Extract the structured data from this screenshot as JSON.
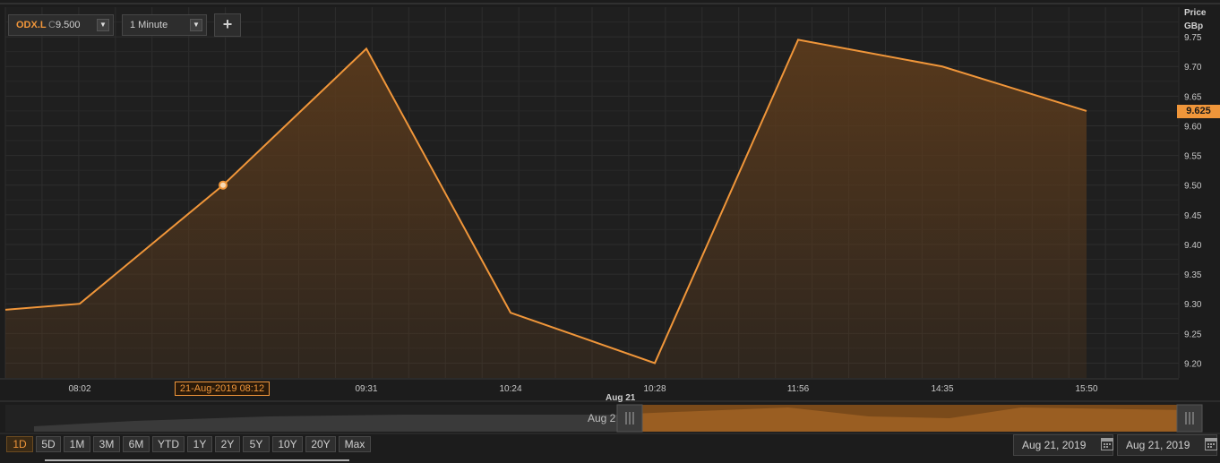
{
  "toolbar": {
    "symbol": "ODX.L",
    "close_prefix": "C",
    "close_value": "9.500",
    "interval": "1 Minute",
    "add_label": "+"
  },
  "y_axis": {
    "title_line1": "Price",
    "title_line2": "GBp",
    "current_price_label": "9.625"
  },
  "crosshair": {
    "date_label": "21-Aug-2019 08:12"
  },
  "navigator": {
    "day_label": "Aug 21",
    "left_label": "Aug 2"
  },
  "range_buttons": [
    "1D",
    "5D",
    "1M",
    "3M",
    "6M",
    "YTD",
    "1Y",
    "2Y",
    "5Y",
    "10Y",
    "20Y",
    "Max"
  ],
  "active_range": "1D",
  "date_range": {
    "from": "Aug 21, 2019",
    "to": "Aug 21, 2019"
  },
  "colors": {
    "line": "#f0963a",
    "fill": "#5a3a1c",
    "price_tag": "#f0963a"
  },
  "chart_data": {
    "type": "area",
    "title": "",
    "xlabel": "",
    "ylabel": "Price GBp",
    "ylim": [
      9.175,
      9.8
    ],
    "yticks": [
      "9.20",
      "9.25",
      "9.30",
      "9.35",
      "9.40",
      "9.45",
      "9.50",
      "9.55",
      "9.60",
      "9.65",
      "9.70",
      "9.75"
    ],
    "xticks": [
      "08:02",
      "09:31",
      "10:24",
      "10:28",
      "11:56",
      "14:35",
      "15:50"
    ],
    "grid": true,
    "series": [
      {
        "x": [
          "",
          "08:02",
          "08:12",
          "09:31",
          "10:24",
          "10:28",
          "11:56",
          "14:35",
          "15:50"
        ],
        "values": [
          9.29,
          9.3,
          9.5,
          9.73,
          9.285,
          9.2,
          9.745,
          9.7,
          9.625
        ]
      }
    ],
    "highlight_point": {
      "x": "08:12",
      "value": 9.5
    },
    "current_value": 9.625
  }
}
